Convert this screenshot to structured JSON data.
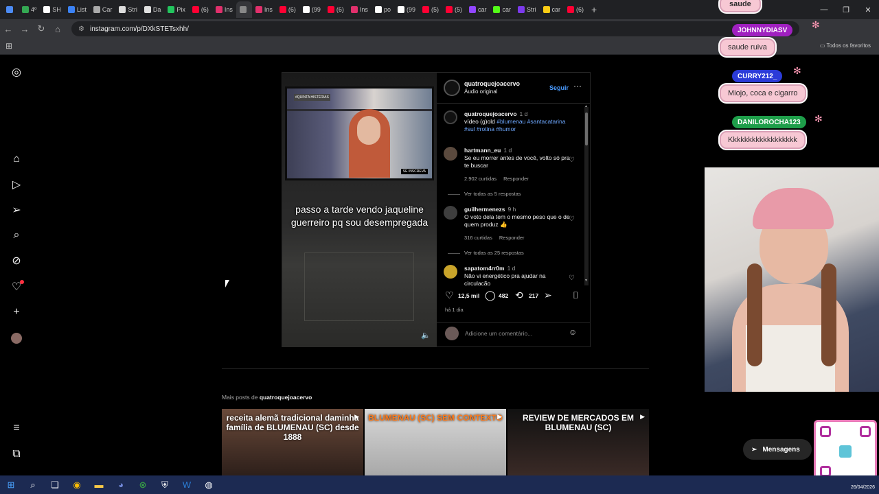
{
  "browser": {
    "tabs": [
      {
        "label": "",
        "color": "#4c8bf5"
      },
      {
        "label": "4º",
        "color": "#34a853"
      },
      {
        "label": "SH",
        "color": "#ffffff"
      },
      {
        "label": "List",
        "color": "#3b82f6"
      },
      {
        "label": "Car",
        "color": "#aaaaaa"
      },
      {
        "label": "Stri",
        "color": "#dddddd"
      },
      {
        "label": "Da",
        "color": "#e0e0e0"
      },
      {
        "label": "Pix",
        "color": "#22c55e"
      },
      {
        "label": "(6)",
        "color": "#ff0033"
      },
      {
        "label": "Ins",
        "color": "#e1306c"
      },
      {
        "label": "",
        "color": "#888888"
      },
      {
        "label": "Ins",
        "color": "#e1306c"
      },
      {
        "label": "(6)",
        "color": "#ff0033"
      },
      {
        "label": "(99",
        "color": "#ffffff"
      },
      {
        "label": "(6)",
        "color": "#ff0033"
      },
      {
        "label": "Ins",
        "color": "#e1306c"
      },
      {
        "label": "po",
        "color": "#ffffff"
      },
      {
        "label": "(99",
        "color": "#ffffff"
      },
      {
        "label": "(5)",
        "color": "#ff0033"
      },
      {
        "label": "(5)",
        "color": "#ff0033"
      },
      {
        "label": "car",
        "color": "#9146ff"
      },
      {
        "label": "car",
        "color": "#53fc18"
      },
      {
        "label": "Stri",
        "color": "#7c3aed"
      },
      {
        "label": "car",
        "color": "#facc15"
      },
      {
        "label": "(6)",
        "color": "#ff0033"
      }
    ],
    "active_tab_index": 10,
    "new_tab": "+",
    "url": "instagram.com/p/DXkSTETsxhh/",
    "all_bookmarks": "Todos os favoritos"
  },
  "instagram": {
    "sidebar_icons": [
      "instagram-logo-icon",
      "home-icon",
      "reels-icon",
      "direct-icon",
      "search-icon",
      "explore-icon",
      "notifications-icon",
      "create-icon",
      "profile-avatar",
      "menu-icon",
      "threads-icon"
    ],
    "post": {
      "username": "quatroquejoacervo",
      "audio": "Áudio original",
      "follow": "Seguir",
      "video_caption": "passo a tarde vendo jaqueline guerreiro pq sou desempregada",
      "tv_badge": "SE INSCREVA",
      "tv_logo": "#QUINTA HISTÉRIAS",
      "caption": {
        "user": "quatroquejoacervo",
        "time": "1 d",
        "text": "vídeo (g)old ",
        "tags": "#blumenau #santacatarina #sul #rotina #humor"
      },
      "comments": [
        {
          "user": "hartmann_eu",
          "time": "1 d",
          "text": "Se eu morrer antes de você, volto só pra te buscar",
          "likes": "2.902 curtidas",
          "reply": "Responder",
          "replies": "Ver todas as 5 respostas"
        },
        {
          "user": "guilhermenezs",
          "time": "9 h",
          "text": "O voto dela tem o mesmo peso que o de quem produz 👍",
          "likes": "316 curtidas",
          "reply": "Responder",
          "replies": "Ver todas as 25 respostas"
        },
        {
          "user": "sapatom4rr0m",
          "time": "1 d",
          "text": "Não vi energético pra ajudar na circulação",
          "likes": "",
          "reply": "",
          "replies": ""
        }
      ],
      "like_count": "12,5 mil",
      "comment_count": "482",
      "repost_count": "217",
      "age": "há 1 dia",
      "add_comment": "Adicione um comentário..."
    },
    "more_posts_prefix": "Mais posts de ",
    "more_posts_user": "quatroquejoacervo",
    "thumbs": [
      {
        "text": "receita alemã tradicional daminha família de BLUMENAU (SC) desde 1888"
      },
      {
        "text": "BLUMENAU (SC) SEM CONTEXTO"
      },
      {
        "text": "REVIEW DE MERCADOS EM BLUMENAU (SC)"
      }
    ],
    "messages_button": "Mensagens"
  },
  "stream_overlay": {
    "chat": [
      {
        "name": "",
        "message": "saude"
      },
      {
        "name": "JOHNNYDIASV",
        "message": "saude ruiva",
        "name_color": "#a020c0"
      },
      {
        "name": "CURRY212_",
        "message": "Miojo, coca e cigarro",
        "name_color": "#2b3bd8"
      },
      {
        "name": "DANILOROCHA123",
        "message": "Kkkkkkkkkkkkkkkkkk",
        "name_color": "#1e9e4a"
      }
    ]
  },
  "taskbar": {
    "date": "26/04/2026",
    "apps": [
      "windows-start-icon",
      "search-icon",
      "task-view-icon",
      "chrome-icon",
      "file-explorer-icon",
      "discord-icon",
      "xbox-icon",
      "shield-icon",
      "word-icon",
      "obs-icon"
    ]
  }
}
